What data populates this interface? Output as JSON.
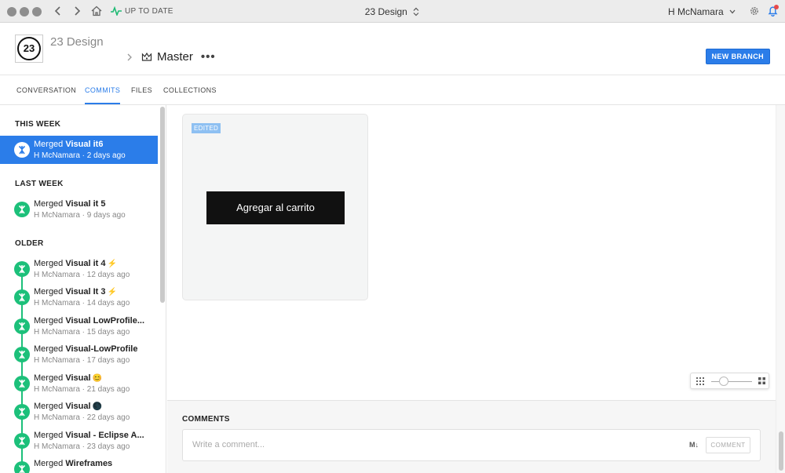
{
  "titlebar": {
    "status_label": "UP TO DATE",
    "window_title": "23 Design",
    "user_name": "H McNamara"
  },
  "project": {
    "logo_text": "23",
    "name": "23 Design",
    "branch_name": "Master",
    "more_label": "•••",
    "new_branch_label": "NEW BRANCH"
  },
  "tabs": [
    {
      "label": "CONVERSATION"
    },
    {
      "label": "COMMITS"
    },
    {
      "label": "FILES"
    },
    {
      "label": "COLLECTIONS"
    }
  ],
  "sidebar": {
    "sections": {
      "this_week": "THIS WEEK",
      "last_week": "LAST WEEK",
      "older": "OLDER"
    },
    "commits": [
      {
        "prefix": "Merged ",
        "title": "Visual it6",
        "emoji": "",
        "meta": "H McNamara · 2 days ago"
      },
      {
        "prefix": "Merged ",
        "title": "Visual it 5",
        "emoji": "",
        "meta": "H McNamara · 9 days ago"
      },
      {
        "prefix": "Merged ",
        "title": "Visual it 4",
        "emoji": "⚡",
        "meta": "H McNamara · 12 days ago"
      },
      {
        "prefix": "Merged ",
        "title": "Visual It 3",
        "emoji": "⚡",
        "meta": "H McNamara · 14 days ago"
      },
      {
        "prefix": "Merged ",
        "title": "Visual LowProfile...",
        "emoji": "",
        "meta": "H McNamara · 15 days ago"
      },
      {
        "prefix": "Merged ",
        "title": "Visual-LowProfile",
        "emoji": "",
        "meta": "H McNamara · 17 days ago"
      },
      {
        "prefix": "Merged ",
        "title": "Visual",
        "emoji": "😊",
        "meta": "H McNamara · 21 days ago"
      },
      {
        "prefix": "Merged ",
        "title": "Visual",
        "emoji": "🌑",
        "meta": "H McNamara · 22 days ago"
      },
      {
        "prefix": "Merged ",
        "title": "Visual - Eclipse A...",
        "emoji": "",
        "meta": "H McNamara · 23 days ago"
      },
      {
        "prefix": "Merged ",
        "title": "Wireframes",
        "emoji": "",
        "meta": ""
      }
    ]
  },
  "canvas": {
    "badge": "EDITED",
    "artboard_button": "Agregar al carrito",
    "zoom_level": 0.3
  },
  "comments": {
    "heading": "COMMENTS",
    "placeholder": "Write a comment...",
    "markdown_label": "M↓",
    "submit_label": "COMMENT"
  },
  "colors": {
    "accent": "#2b7de9",
    "commit_green": "#1cc07a"
  }
}
